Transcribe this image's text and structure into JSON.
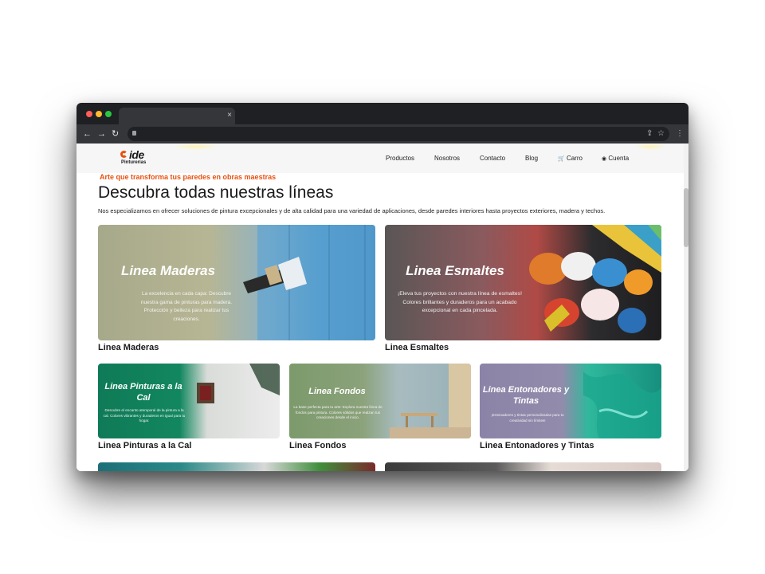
{
  "browser": {
    "tab_close": "×",
    "nav_back": "←",
    "nav_forward": "→",
    "nav_reload": "↻",
    "share_icon": "⇪",
    "star_icon": "☆",
    "menu_icon": "⋮"
  },
  "site": {
    "logo_word": "ide",
    "logo_sub": "Pinturerías",
    "menu": {
      "products": "Productos",
      "about": "Nosotros",
      "contact": "Contacto",
      "blog": "Blog",
      "cart": "Carro",
      "account": "Cuenta"
    },
    "cart_icon": "🛒",
    "account_icon": "◉",
    "slogan": "Arte que transforma tus paredes en obras maestras",
    "heading": "Descubra todas nuestras líneas",
    "intro": "Nos especializamos en ofrecer soluciones de pintura excepcionales y de alta calidad para una variedad de aplicaciones, desde paredes interiores hasta proyectos exteriores, madera y techos."
  },
  "cards": [
    {
      "title": "Linea Maderas",
      "desc": "La excelencia en cada capa: Descubre nuestra gama de pinturas para madera. Protección y belleza para realizar tus creaciones.",
      "caption": "Linea Maderas"
    },
    {
      "title": "Linea Esmaltes",
      "desc": "¡Eleva tus proyectos con nuestra línea de esmaltes! Colores brillantes y duraderos para un acabado excepcional en cada pincelada.",
      "caption": "Linea Esmaltes"
    },
    {
      "title": "Linea Pinturas a la Cal",
      "desc": "Descubre el encanto atemporal de la pintura a la cal. Colores vibrantes y duraderos en igual para tu hogar.",
      "caption": "Linea Pinturas a la Cal"
    },
    {
      "title": "Linea Fondos",
      "desc": "La base perfecta para tu arte: Explora nuestra línea de fondos para pintura. Colores sólidos que realzan tus creaciones desde el inicio.",
      "caption": "Linea Fondos"
    },
    {
      "title": "Linea Entonadores y Tintas",
      "desc": "¡Entonadores y tintas personalizadas para tu creatividad sin límites!",
      "caption": "Linea Entonadores y Tintas"
    }
  ],
  "colors": {
    "accent": "#e8500f",
    "browser_dark": "#1f2023",
    "toolbar": "#35363a"
  }
}
